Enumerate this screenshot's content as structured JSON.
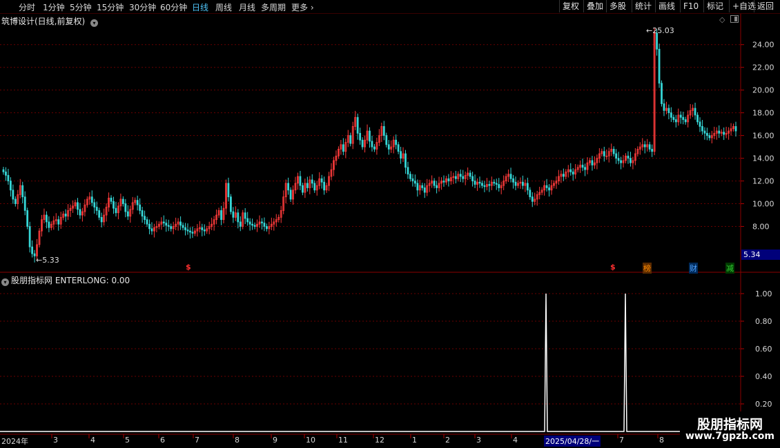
{
  "toolbar": {
    "periods": [
      "分时",
      "1分钟",
      "5分钟",
      "15分钟",
      "30分钟",
      "60分钟",
      "日线",
      "周线",
      "月线",
      "多周期",
      "更多"
    ],
    "active_period": "日线",
    "buttons": [
      "复权",
      "叠加",
      "多股",
      "统计",
      "画线",
      "F10",
      "标记",
      "+自选",
      "返回"
    ]
  },
  "main_panel": {
    "title": "筑博设计(日线,前复权)",
    "price_labels": [
      "24.00",
      "22.00",
      "20.00",
      "18.00",
      "16.00",
      "14.00",
      "12.00",
      "10.00",
      "8.00"
    ],
    "current_price": "5.34",
    "high_label": "25.03",
    "low_label": "5.33",
    "markers": [
      {
        "text": "$",
        "color": "#ff3030"
      },
      {
        "text": "$",
        "color": "#ff3030"
      },
      {
        "text": "榜",
        "color": "#ff8c00"
      },
      {
        "text": "财",
        "color": "#4fa3ff"
      },
      {
        "text": "减",
        "color": "#33cc33"
      }
    ]
  },
  "indicator_panel": {
    "title": "股朋指标网 ENTERLONG: 0.00",
    "axis_labels": [
      "1.00",
      "0.80",
      "0.60",
      "0.40",
      "0.20"
    ]
  },
  "date_axis": {
    "start_label": "2024年",
    "months": [
      "3",
      "4",
      "5",
      "6",
      "7",
      "8",
      "9",
      "10",
      "11",
      "12",
      "1",
      "2",
      "3",
      "4",
      "7",
      "8"
    ],
    "cursor_date": "2025/04/28/一"
  },
  "watermark": {
    "title": "股朋指标网",
    "url": "www.7gpzb.com"
  },
  "chart_data": {
    "type": "candlestick",
    "title": "筑博设计(日线,前复权)",
    "ylim": [
      5.0,
      25.5
    ],
    "y_ticks": [
      8,
      10,
      12,
      14,
      16,
      18,
      20,
      22,
      24
    ],
    "high": 25.03,
    "low": 5.33,
    "last": 5.34,
    "close_series": [
      12.8,
      12.5,
      12.0,
      11.2,
      10.4,
      10.0,
      10.8,
      11.6,
      10.6,
      9.4,
      8.0,
      6.2,
      5.6,
      5.4,
      6.4,
      7.6,
      8.6,
      9.0,
      8.4,
      7.9,
      8.2,
      8.5,
      8.6,
      8.2,
      8.8,
      9.1,
      8.9,
      9.4,
      9.6,
      9.8,
      10.1,
      9.5,
      9.0,
      9.3,
      9.9,
      10.4,
      10.6,
      10.1,
      9.7,
      9.4,
      8.8,
      8.4,
      9.0,
      9.7,
      10.5,
      10.2,
      9.6,
      9.2,
      9.8,
      10.4,
      10.0,
      9.3,
      8.9,
      9.5,
      10.1,
      10.3,
      9.9,
      9.4,
      8.9,
      8.6,
      8.2,
      7.8,
      7.6,
      7.9,
      8.0,
      8.2,
      8.4,
      8.3,
      8.1,
      8.0,
      7.8,
      8.0,
      8.2,
      8.4,
      8.1,
      7.9,
      7.7,
      7.6,
      7.5,
      7.4,
      7.6,
      7.8,
      7.9,
      7.7,
      7.6,
      7.8,
      8.0,
      8.2,
      8.6,
      9.0,
      9.4,
      8.6,
      9.6,
      11.8,
      10.6,
      9.3,
      8.8,
      9.2,
      8.4,
      8.0,
      9.2,
      8.7,
      8.4,
      8.2,
      8.1,
      8.0,
      8.2,
      8.4,
      8.3,
      8.0,
      7.8,
      8.0,
      8.2,
      8.4,
      8.6,
      8.8,
      9.4,
      10.6,
      11.8,
      11.2,
      10.4,
      11.2,
      11.8,
      12.4,
      11.6,
      11.0,
      11.8,
      11.4,
      12.1,
      11.8,
      11.2,
      11.6,
      12.2,
      11.9,
      11.2,
      11.6,
      12.4,
      13.0,
      13.8,
      14.2,
      14.8,
      15.2,
      14.6,
      15.4,
      16.0,
      15.3,
      16.8,
      17.6,
      16.2,
      15.6,
      15.0,
      15.6,
      16.4,
      15.5,
      15.0,
      14.8,
      15.4,
      16.0,
      16.8,
      16.0,
      15.2,
      14.8,
      15.0,
      15.6,
      15.2,
      14.6,
      14.0,
      14.4,
      13.2,
      12.6,
      12.2,
      12.0,
      11.8,
      11.2,
      11.6,
      11.4,
      11.0,
      11.6,
      11.8,
      12.0,
      11.6,
      11.4,
      11.8,
      12.0,
      11.9,
      12.2,
      12.0,
      12.3,
      12.4,
      12.2,
      12.6,
      12.4,
      12.2,
      12.5,
      12.7,
      12.4,
      12.0,
      11.7,
      11.9,
      11.8,
      11.6,
      11.5,
      11.7,
      11.6,
      11.9,
      11.8,
      11.7,
      11.4,
      11.6,
      12.0,
      12.4,
      12.6,
      12.2,
      11.9,
      11.6,
      11.8,
      11.9,
      11.6,
      11.8,
      11.2,
      10.6,
      10.2,
      10.4,
      10.8,
      11.0,
      11.2,
      11.6,
      11.4,
      11.2,
      11.6,
      11.8,
      12.0,
      12.4,
      12.6,
      12.4,
      12.8,
      13.0,
      12.8,
      12.6,
      13.0,
      13.2,
      13.4,
      13.2,
      13.0,
      13.6,
      13.8,
      13.4,
      13.6,
      14.0,
      14.4,
      14.6,
      14.2,
      14.2,
      14.6,
      14.8,
      14.4,
      14.0,
      13.8,
      13.6,
      13.8,
      14.2,
      14.0,
      13.6,
      13.8,
      14.4,
      14.8,
      15.0,
      15.2,
      15.0,
      15.2,
      14.8,
      14.6,
      25.0,
      23.6,
      20.6,
      18.8,
      18.2,
      18.4,
      18.0,
      17.6,
      17.4,
      17.2,
      17.8,
      17.6,
      17.4,
      17.2,
      17.8,
      18.2,
      18.4,
      17.8,
      17.2,
      16.8,
      16.4,
      16.2,
      16.0,
      15.8,
      16.0,
      16.2,
      16.4,
      16.2,
      16.3,
      16.1,
      16.2,
      16.4,
      16.6,
      16.8,
      16.4
    ]
  },
  "indicator_data": {
    "name": "ENTERLONG",
    "ylim": [
      0,
      1.05
    ],
    "y_ticks": [
      1.0,
      0.8,
      0.6,
      0.4,
      0.2
    ],
    "value": 0.0,
    "signal_dates": [
      "2025/04/28",
      "2025/07"
    ],
    "signal_value": 1.0
  }
}
